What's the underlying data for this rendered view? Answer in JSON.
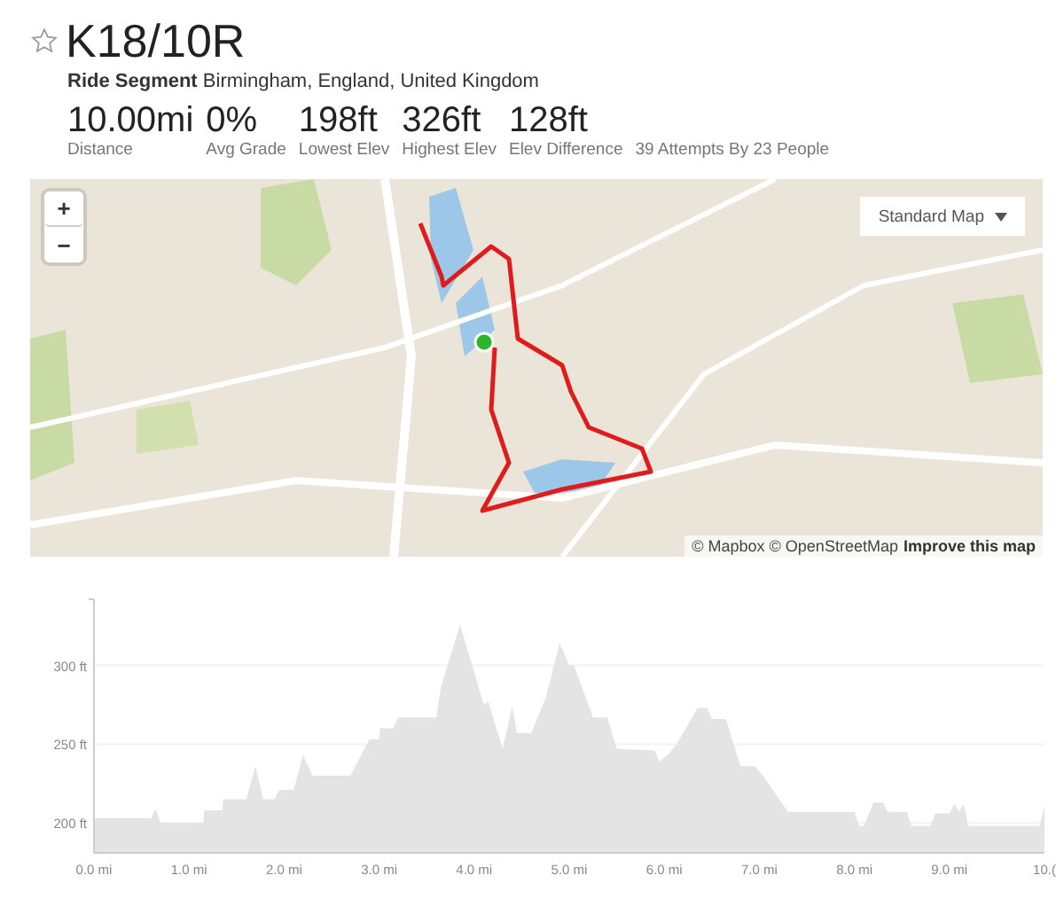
{
  "title": "K18/10R",
  "starred": false,
  "segment": {
    "type_label": "Ride Segment",
    "location": "Birmingham, England, United Kingdom"
  },
  "stats": [
    {
      "value": "10.00mi",
      "label": "Distance"
    },
    {
      "value": "0%",
      "label": "Avg Grade"
    },
    {
      "value": "198ft",
      "label": "Lowest Elev"
    },
    {
      "value": "326ft",
      "label": "Highest Elev"
    },
    {
      "value": "128ft",
      "label": "Elev Difference"
    }
  ],
  "attempts": "39 Attempts By 23 People",
  "map": {
    "kind": "picture",
    "zoom_in": "+",
    "zoom_out": "−",
    "style_menu": "Standard Map",
    "attribution": "© Mapbox © OpenStreetMap",
    "improve_link": "Improve this map"
  },
  "elevation": {
    "chart_data": {
      "type": "area",
      "x": [
        0,
        0.6,
        0.65,
        0.7,
        1.15,
        1.16,
        1.35,
        1.36,
        1.6,
        1.7,
        1.78,
        1.9,
        1.95,
        2.1,
        2.2,
        2.3,
        2.7,
        2.8,
        2.9,
        3.0,
        3.01,
        3.15,
        3.2,
        3.6,
        3.65,
        3.85,
        4.1,
        4.15,
        4.3,
        4.4,
        4.45,
        4.6,
        4.75,
        4.9,
        5.0,
        5.05,
        5.25,
        5.4,
        5.5,
        5.9,
        5.95,
        6.05,
        6.15,
        6.35,
        6.45,
        6.5,
        6.65,
        6.8,
        6.95,
        7.05,
        7.3,
        8.0,
        8.05,
        8.1,
        8.2,
        8.3,
        8.35,
        8.55,
        8.6,
        8.8,
        8.85,
        9.0,
        9.05,
        9.1,
        9.15,
        9.2,
        9.95,
        10.0
      ],
      "series": [
        {
          "color": "#e4e4e4",
          "values": [
            203,
            203,
            209,
            200,
            200,
            208,
            208,
            215,
            215,
            236,
            215,
            215,
            221,
            221,
            243,
            230,
            230,
            242,
            253,
            253,
            260,
            260,
            267,
            267,
            286,
            326,
            275,
            277,
            247,
            274,
            257,
            257,
            279,
            314,
            300,
            300,
            267,
            267,
            247,
            246,
            239,
            244,
            252,
            273,
            273,
            266,
            266,
            236,
            236,
            229,
            207,
            207,
            198,
            198,
            213,
            213,
            207,
            207,
            198,
            198,
            206,
            206,
            212,
            207,
            212,
            198,
            198,
            211
          ]
        }
      ],
      "grid": true,
      "xlim": [
        0,
        10
      ],
      "ylim": [
        181,
        342
      ],
      "xticks": [
        {
          "value": 0,
          "label": "0.0 mi"
        },
        {
          "value": 1,
          "label": "1.0 mi"
        },
        {
          "value": 2,
          "label": "2.0 mi"
        },
        {
          "value": 3,
          "label": "3.0 mi"
        },
        {
          "value": 4,
          "label": "4.0 mi"
        },
        {
          "value": 5,
          "label": "5.0 mi"
        },
        {
          "value": 6,
          "label": "6.0 mi"
        },
        {
          "value": 7,
          "label": "7.0 mi"
        },
        {
          "value": 8,
          "label": "8.0 mi"
        },
        {
          "value": 9,
          "label": "9.0 mi"
        },
        {
          "value": 10,
          "label": "10.("
        }
      ],
      "yticks": [
        {
          "value": 200,
          "label": "200 ft"
        },
        {
          "value": 250,
          "label": "250 ft"
        },
        {
          "value": 300,
          "label": "300 ft"
        }
      ]
    }
  }
}
